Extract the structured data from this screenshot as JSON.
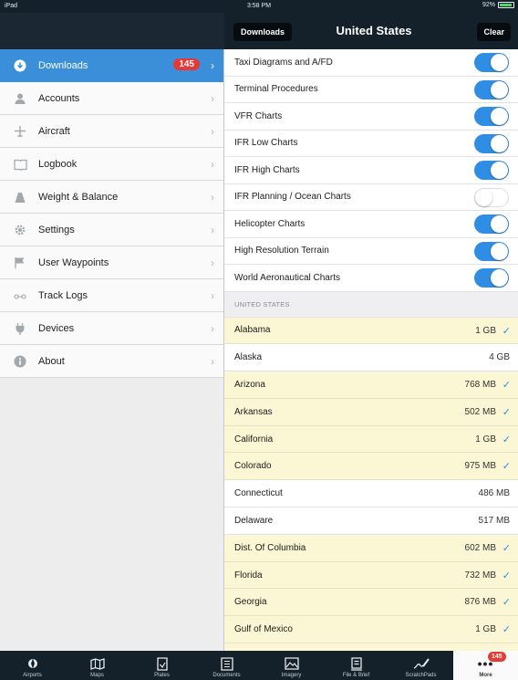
{
  "status": {
    "device": "iPad",
    "time": "3:58 PM",
    "battery": "92%"
  },
  "nav": {
    "back_label": "Downloads",
    "title": "United States",
    "clear_label": "Clear"
  },
  "sidebar": {
    "items": [
      {
        "label": "Downloads",
        "icon": "download-icon",
        "badge": "145"
      },
      {
        "label": "Accounts",
        "icon": "person-icon"
      },
      {
        "label": "Aircraft",
        "icon": "airplane-icon"
      },
      {
        "label": "Logbook",
        "icon": "book-icon"
      },
      {
        "label": "Weight & Balance",
        "icon": "scale-icon"
      },
      {
        "label": "Settings",
        "icon": "gear-icon"
      },
      {
        "label": "User Waypoints",
        "icon": "flag-icon"
      },
      {
        "label": "Track Logs",
        "icon": "track-icon"
      },
      {
        "label": "Devices",
        "icon": "plug-icon"
      },
      {
        "label": "About",
        "icon": "info-icon"
      }
    ]
  },
  "charts": [
    {
      "label": "Taxi Diagrams and A/FD",
      "on": true
    },
    {
      "label": "Terminal Procedures",
      "on": true
    },
    {
      "label": "VFR Charts",
      "on": true
    },
    {
      "label": "IFR Low Charts",
      "on": true
    },
    {
      "label": "IFR High Charts",
      "on": true
    },
    {
      "label": "IFR Planning / Ocean Charts",
      "on": false
    },
    {
      "label": "Helicopter Charts",
      "on": true
    },
    {
      "label": "High Resolution Terrain",
      "on": true
    },
    {
      "label": "World Aeronautical Charts",
      "on": true
    }
  ],
  "section_header": "UNITED STATES",
  "states": [
    {
      "name": "Alabama",
      "size": "1 GB",
      "selected": true
    },
    {
      "name": "Alaska",
      "size": "4 GB",
      "selected": false
    },
    {
      "name": "Arizona",
      "size": "768 MB",
      "selected": true
    },
    {
      "name": "Arkansas",
      "size": "502 MB",
      "selected": true
    },
    {
      "name": "California",
      "size": "1 GB",
      "selected": true
    },
    {
      "name": "Colorado",
      "size": "975 MB",
      "selected": true
    },
    {
      "name": "Connecticut",
      "size": "486 MB",
      "selected": false
    },
    {
      "name": "Delaware",
      "size": "517 MB",
      "selected": false
    },
    {
      "name": "Dist. Of Columbia",
      "size": "602 MB",
      "selected": true
    },
    {
      "name": "Florida",
      "size": "732 MB",
      "selected": true
    },
    {
      "name": "Georgia",
      "size": "876 MB",
      "selected": true
    },
    {
      "name": "Gulf of Mexico",
      "size": "1 GB",
      "selected": true
    }
  ],
  "tabs": [
    {
      "label": "Airports",
      "icon": "airports-icon"
    },
    {
      "label": "Maps",
      "icon": "maps-icon"
    },
    {
      "label": "Plates",
      "icon": "plates-icon"
    },
    {
      "label": "Documents",
      "icon": "documents-icon"
    },
    {
      "label": "Imagery",
      "icon": "imagery-icon"
    },
    {
      "label": "File & Brief",
      "icon": "file-brief-icon"
    },
    {
      "label": "ScratchPads",
      "icon": "scratchpads-icon"
    },
    {
      "label": "More",
      "icon": "more-icon",
      "badge": "145"
    }
  ]
}
